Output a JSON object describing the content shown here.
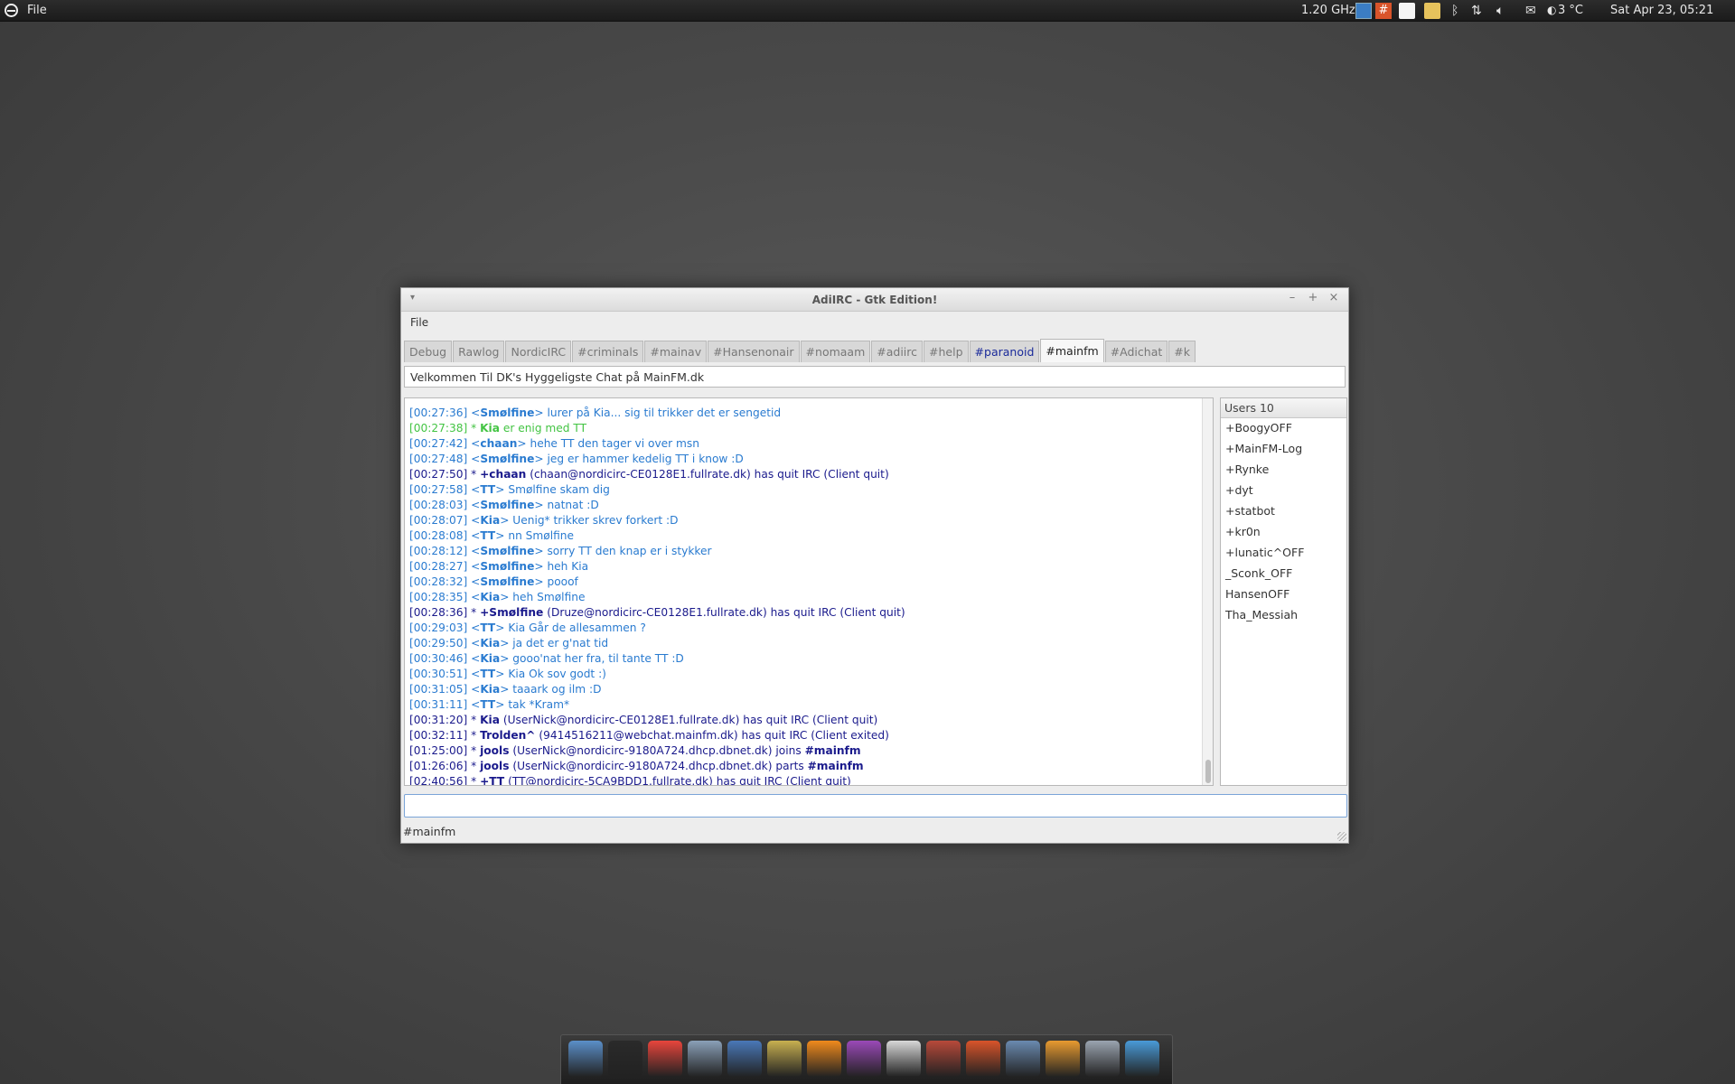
{
  "panel": {
    "app_menu": "File",
    "cpu": "1.20 GHz",
    "weather": "3 °C",
    "clock": "Sat Apr 23, 05:21"
  },
  "window": {
    "title": "AdiIRC - Gtk Edition!",
    "menu_file": "File",
    "tabs": [
      {
        "label": "Debug",
        "state": "normal"
      },
      {
        "label": "Rawlog",
        "state": "normal"
      },
      {
        "label": "NordicIRC",
        "state": "normal"
      },
      {
        "label": "#criminals",
        "state": "normal"
      },
      {
        "label": "#mainav",
        "state": "normal"
      },
      {
        "label": "#Hansenonair",
        "state": "normal"
      },
      {
        "label": "#nomaam",
        "state": "normal"
      },
      {
        "label": "#adiirc",
        "state": "normal"
      },
      {
        "label": "#help",
        "state": "normal"
      },
      {
        "label": "#paranoid",
        "state": "highlight"
      },
      {
        "label": "#mainfm",
        "state": "active"
      },
      {
        "label": "#Adichat",
        "state": "normal"
      },
      {
        "label": "#k",
        "state": "normal"
      }
    ],
    "topic": "Velkommen Til DK's Hyggeligste Chat på MainFM.dk",
    "chat": [
      {
        "kind": "msg",
        "time": "[00:27:36]",
        "nick": "Smølfine",
        "text": "lurer på Kia... sig til trikker det er sengetid"
      },
      {
        "kind": "action",
        "time": "[00:27:38]",
        "nick": "Kia",
        "text": "er enig med TT"
      },
      {
        "kind": "msg",
        "time": "[00:27:42]",
        "nick": "chaan",
        "text": "hehe TT den tager vi over msn"
      },
      {
        "kind": "msg",
        "time": "[00:27:48]",
        "nick": "Smølfine",
        "text": "jeg er hammer kedelig TT i know :D"
      },
      {
        "kind": "quit",
        "time": "[00:27:50]",
        "nick": "+chaan",
        "text": "(chaan@nordicirc-CE0128E1.fullrate.dk) has quit IRC (Client quit)"
      },
      {
        "kind": "msg",
        "time": "[00:27:58]",
        "nick": "TT",
        "text": "Smølfine skam dig"
      },
      {
        "kind": "msg",
        "time": "[00:28:03]",
        "nick": "Smølfine",
        "text": "natnat :D"
      },
      {
        "kind": "msg",
        "time": "[00:28:07]",
        "nick": "Kia",
        "text": "Uenig* trikker skrev forkert :D"
      },
      {
        "kind": "msg",
        "time": "[00:28:08]",
        "nick": "TT",
        "text": "nn Smølfine"
      },
      {
        "kind": "msg",
        "time": "[00:28:12]",
        "nick": "Smølfine",
        "text": "sorry TT den knap er i stykker"
      },
      {
        "kind": "msg",
        "time": "[00:28:27]",
        "nick": "Smølfine",
        "text": "heh Kia"
      },
      {
        "kind": "msg",
        "time": "[00:28:32]",
        "nick": "Smølfine",
        "text": "pooof"
      },
      {
        "kind": "msg",
        "time": "[00:28:35]",
        "nick": "Kia",
        "text": "heh Smølfine"
      },
      {
        "kind": "quit",
        "time": "[00:28:36]",
        "nick": "+Smølfine",
        "text": "(Druze@nordicirc-CE0128E1.fullrate.dk) has quit IRC (Client quit)"
      },
      {
        "kind": "msg",
        "time": "[00:29:03]",
        "nick": "TT",
        "text": "Kia Går de allesammen ?"
      },
      {
        "kind": "msg",
        "time": "[00:29:50]",
        "nick": "Kia",
        "text": "ja det er g'nat tid"
      },
      {
        "kind": "msg",
        "time": "[00:30:46]",
        "nick": "Kia",
        "text": "gooo'nat her fra, til tante TT :D"
      },
      {
        "kind": "msg",
        "time": "[00:30:51]",
        "nick": "TT",
        "text": "Kia Ok sov godt :)"
      },
      {
        "kind": "msg",
        "time": "[00:31:05]",
        "nick": "Kia",
        "text": "taaark og ilm :D"
      },
      {
        "kind": "msg",
        "time": "[00:31:11]",
        "nick": "TT",
        "text": "tak *Kram*"
      },
      {
        "kind": "quit",
        "time": "[00:31:20]",
        "nick": "Kia",
        "text": "(UserNick@nordicirc-CE0128E1.fullrate.dk) has quit IRC (Client quit)"
      },
      {
        "kind": "quit",
        "time": "[00:32:11]",
        "nick": "Trolden^",
        "text": "(9414516211@webchat.mainfm.dk) has quit IRC (Client exited)"
      },
      {
        "kind": "quit",
        "time": "[01:25:00]",
        "nick": "jools",
        "text": "(UserNick@nordicirc-9180A724.dhcp.dbnet.dk) joins",
        "channel": "#mainfm"
      },
      {
        "kind": "quit",
        "time": "[01:26:06]",
        "nick": "jools",
        "text": "(UserNick@nordicirc-9180A724.dhcp.dbnet.dk) parts",
        "channel": "#mainfm"
      },
      {
        "kind": "quit",
        "time": "[02:40:56]",
        "nick": "+TT",
        "text": "(TT@nordicirc-5CA9BDD1.fullrate.dk) has quit IRC (Client quit)"
      }
    ],
    "users_header": "Users 10",
    "users": [
      "+BoogyOFF",
      "+MainFM-Log",
      "+Rynke",
      "+dyt",
      "+statbot",
      "+kr0n",
      "+lunatic^OFF",
      "_Sconk_OFF",
      "HansenOFF",
      "Tha_Messiah"
    ],
    "input_value": "",
    "status": "#mainfm"
  },
  "dock_icons": [
    "file-manager-icon",
    "terminal-icon",
    "chrome-icon",
    "news-icon",
    "mail-icon",
    "audio-player-icon",
    "vlc-icon",
    "pidgin-icon",
    "text-editor-icon",
    "installer-icon",
    "adiirc-icon",
    "window-icon",
    "virtualbox-icon",
    "trash-icon",
    "show-desktop-icon"
  ]
}
